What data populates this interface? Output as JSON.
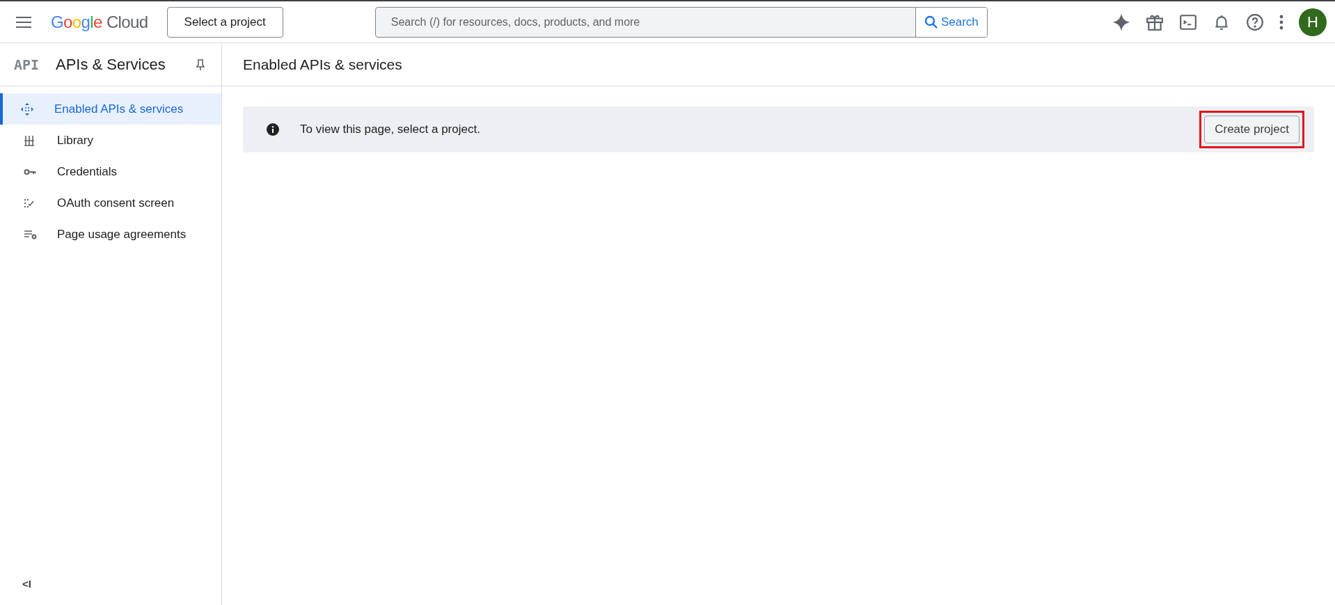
{
  "header": {
    "logo": {
      "brand": "Google",
      "product": "Cloud"
    },
    "project_button": "Select a project",
    "search": {
      "placeholder": "Search (/) for resources, docs, products, and more",
      "button": "Search"
    },
    "avatar": "H"
  },
  "sidebar": {
    "badge": "API",
    "title": "APIs & Services",
    "items": [
      {
        "label": "Enabled APIs & services",
        "kind": "enabled",
        "selected": true
      },
      {
        "label": "Library",
        "kind": "library",
        "selected": false
      },
      {
        "label": "Credentials",
        "kind": "credentials",
        "selected": false
      },
      {
        "label": "OAuth consent screen",
        "kind": "oauth",
        "selected": false
      },
      {
        "label": "Page usage agreements",
        "kind": "agreements",
        "selected": false
      }
    ],
    "collapse": "<I"
  },
  "main": {
    "title": "Enabled APIs & services",
    "banner": {
      "message": "To view this page, select a project.",
      "button": "Create project",
      "highlighted": true
    }
  }
}
